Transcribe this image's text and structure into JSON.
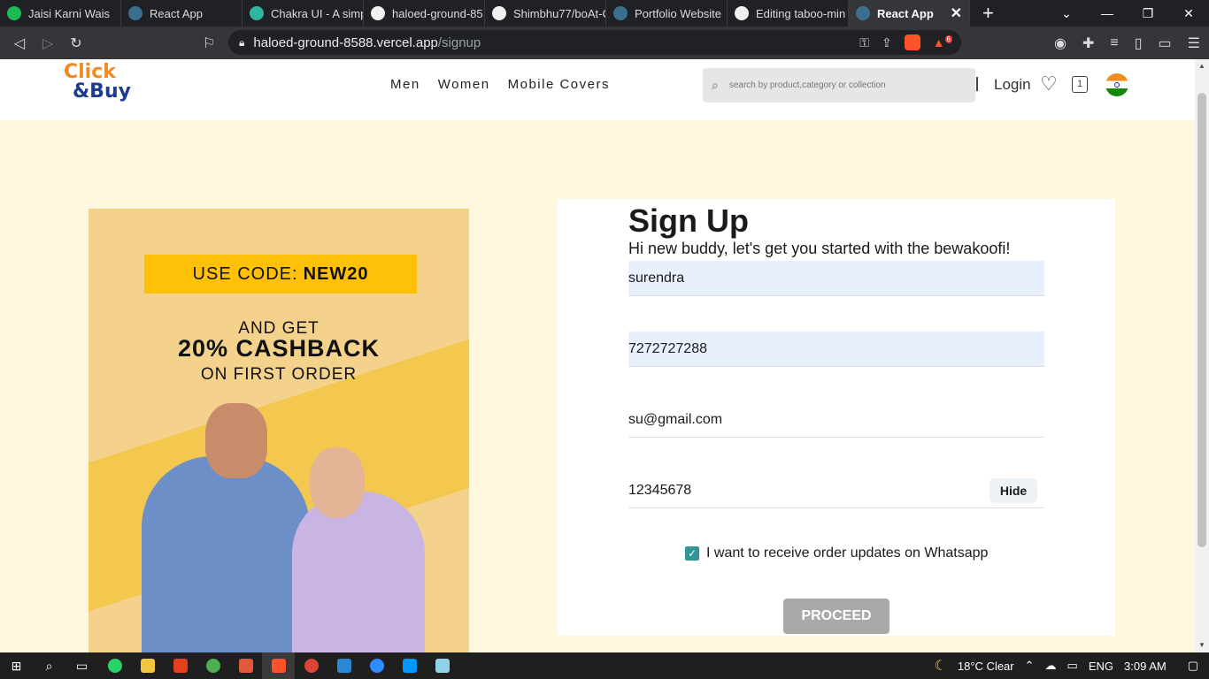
{
  "browser": {
    "tabs": [
      {
        "label": "Jaisi Karni Wais",
        "color": "#1db954"
      },
      {
        "label": "React App",
        "color": "#4d8fb5"
      },
      {
        "label": "Chakra UI - A simp",
        "color": "#2fb5a0"
      },
      {
        "label": "haloed-ground-85",
        "color": "#f0f0f0"
      },
      {
        "label": "Shimbhu77/boAt-C",
        "color": "#f0f0f0"
      },
      {
        "label": "Portfolio Website",
        "color": "#4d8fb5"
      },
      {
        "label": "Editing taboo-min",
        "color": "#f0f0f0"
      },
      {
        "label": "React App",
        "color": "#4d8fb5",
        "active": true
      }
    ],
    "new_tab": "+",
    "url_host": "haloed-ground-8588.vercel.app",
    "url_path": "/signup",
    "brave_badge": "6"
  },
  "header": {
    "logo_line1": "Click",
    "logo_line2": "&Buy",
    "nav": [
      "Men",
      "Women",
      "Mobile Covers"
    ],
    "search_placeholder": "search by product,category or collection",
    "login": "Login",
    "bag_count": "1"
  },
  "promo": {
    "code_prefix": "USE CODE:",
    "code": "NEW20",
    "line1": "AND GET",
    "line2": "20% CASHBACK",
    "line3": "ON FIRST ORDER"
  },
  "signup": {
    "title": "Sign Up",
    "subtitle": "Hi new buddy, let's get you started with the bewakoofi!",
    "name_value": "surendra",
    "phone_value": "7272727288",
    "email_value": "su@gmail.com",
    "password_value": "12345678",
    "hide_label": "Hide",
    "whatsapp_label": "I want to receive order updates on Whatsapp",
    "whatsapp_checked": true,
    "proceed_label": "PROCEED"
  },
  "taskbar": {
    "weather": "18°C  Clear",
    "lang": "ENG",
    "time": "3:09 AM"
  }
}
